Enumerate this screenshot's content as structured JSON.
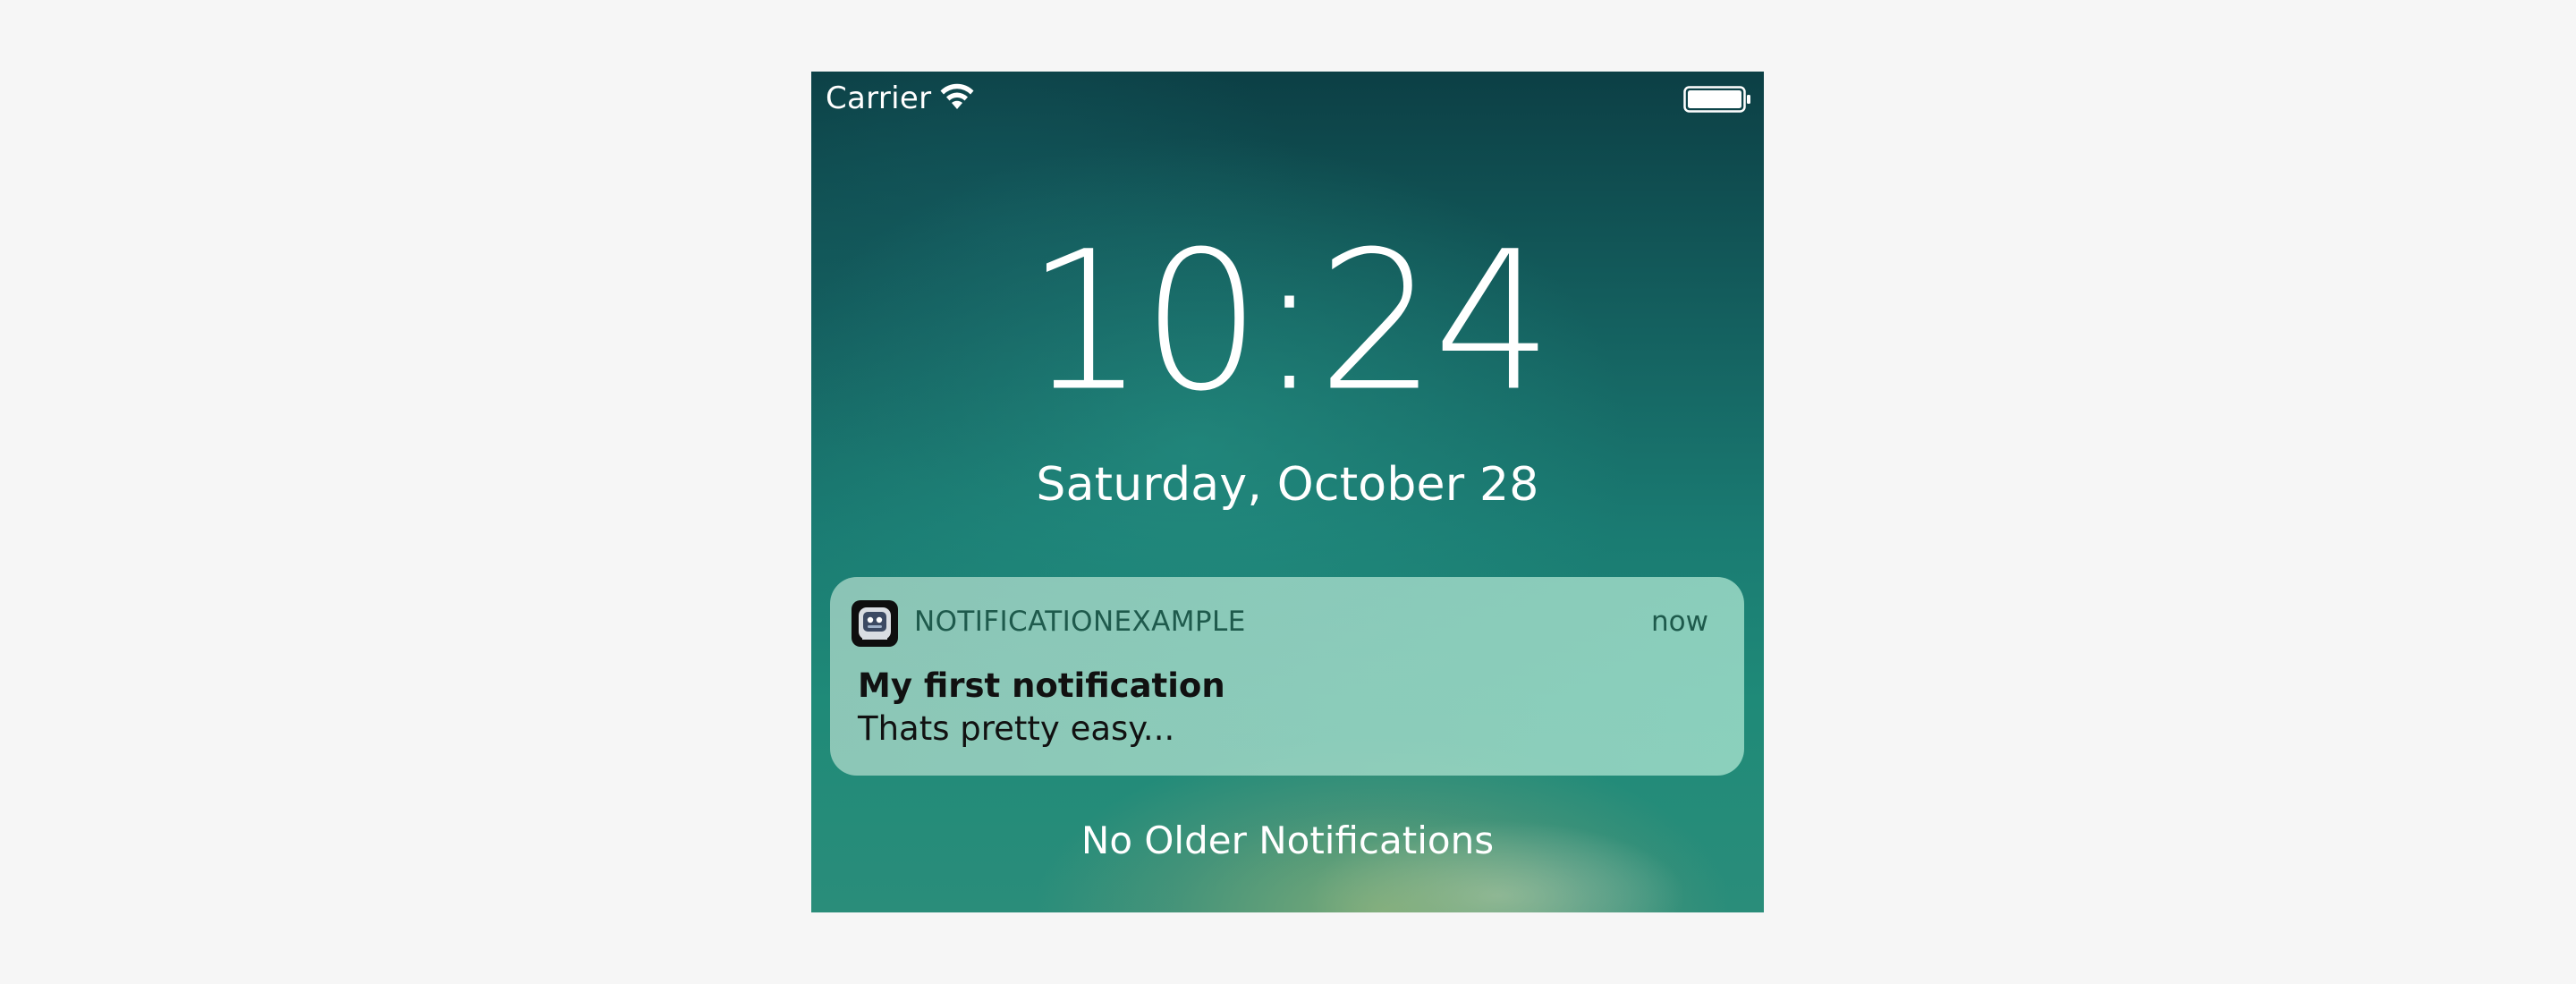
{
  "status_bar": {
    "carrier": "Carrier",
    "wifi_icon": "wifi-icon",
    "battery_icon": "battery-icon",
    "battery_level": 1.0
  },
  "lock_screen": {
    "time": "10:24",
    "date": "Saturday, October 28"
  },
  "notification": {
    "app_icon": "app-icon",
    "app_name": "NOTIFICATIONEXAMPLE",
    "time": "now",
    "title": "My first notification",
    "body": "Thats pretty easy..."
  },
  "footer": {
    "no_older": "No Older Notifications"
  },
  "colors": {
    "page_background": "#f6f6f6",
    "notification_text": "#1e5a4c",
    "text_primary": "#ffffff"
  }
}
